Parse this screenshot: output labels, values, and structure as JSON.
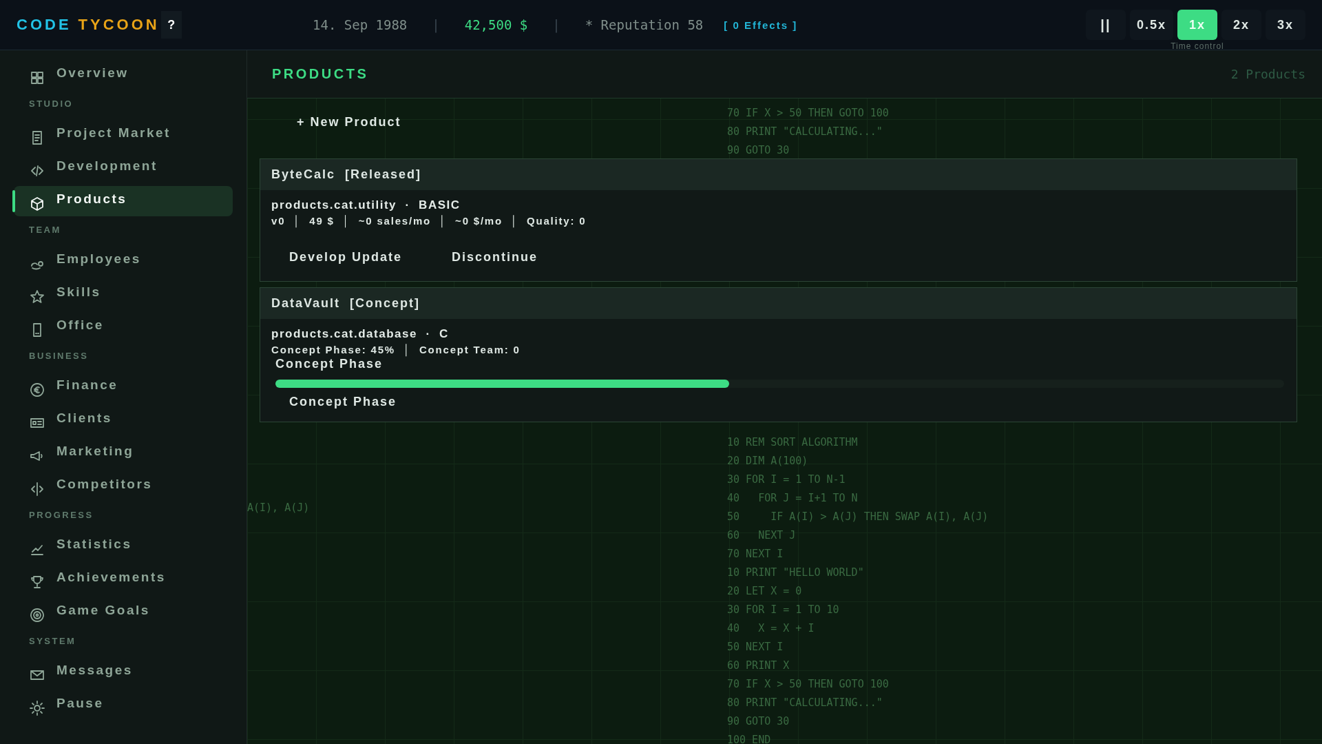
{
  "topbar": {
    "logo": [
      {
        "text": "CODE",
        "color": "#22c3e6"
      },
      {
        "text": "TYCOON",
        "color": "#e8a317"
      }
    ],
    "help": "?",
    "status": [
      {
        "kind": "date",
        "text": "14. Sep 1988"
      },
      {
        "kind": "sep",
        "text": "|"
      },
      {
        "kind": "money",
        "text": "42,500 $"
      },
      {
        "kind": "sep",
        "text": "|"
      },
      {
        "kind": "reputation",
        "text": "* Reputation 58"
      },
      {
        "kind": "effects",
        "text": "[ 0 Effects ]"
      }
    ],
    "pause": "||",
    "speeds": [
      {
        "label": "0.5x",
        "selected": false
      },
      {
        "label": "1x",
        "selected": true
      },
      {
        "label": "2x",
        "selected": false
      },
      {
        "label": "3x",
        "selected": false
      }
    ],
    "time_control_label": "Time control"
  },
  "sidebar": [
    {
      "items": [
        {
          "label": "Overview",
          "selected": false
        }
      ]
    },
    {
      "section": "STUDIO",
      "items": [
        {
          "label": "Project Market",
          "selected": false
        },
        {
          "label": "Development",
          "selected": false
        },
        {
          "label": "Products",
          "selected": true
        }
      ]
    },
    {
      "section": "TEAM",
      "items": [
        {
          "label": "Employees",
          "selected": false
        },
        {
          "label": "Skills",
          "selected": false
        },
        {
          "label": "Office",
          "selected": false
        }
      ]
    },
    {
      "section": "BUSINESS",
      "items": [
        {
          "label": "Finance",
          "selected": false
        },
        {
          "label": "Clients",
          "selected": false
        },
        {
          "label": "Marketing",
          "selected": false
        },
        {
          "label": "Competitors",
          "selected": false
        }
      ]
    },
    {
      "section": "PROGRESS",
      "items": [
        {
          "label": "Statistics",
          "selected": false
        },
        {
          "label": "Achievements",
          "selected": false
        },
        {
          "label": "Game Goals",
          "selected": false
        }
      ]
    },
    {
      "section": "SYSTEM",
      "items": [
        {
          "label": "Messages",
          "selected": false
        },
        {
          "label": "Pause",
          "selected": false
        }
      ]
    }
  ],
  "page": {
    "title": "PRODUCTS",
    "count": "2 Products",
    "new_button": "+ New Product",
    "products": [
      {
        "kind": "released",
        "name": "ByteCalc",
        "status": "[Released]",
        "category": "products.cat.utility  ·  BASIC",
        "stats": "v0  │  49 $  │  ~0 sales/mo  │  ~0 $/mo  │  Quality: 0",
        "actions": [
          "Develop Update",
          "Discontinue"
        ]
      },
      {
        "kind": "concept",
        "name": "DataVault",
        "status": "[Concept]",
        "category": "products.cat.database  ·  C",
        "stats": "Concept Phase: 45%  │  Concept Team: 0",
        "phase_label": "Concept Phase",
        "level": 0.45,
        "actions": [
          "Concept Phase"
        ]
      }
    ]
  },
  "background_code": [
    {
      "lines": [
        "70 IF X > 50 THEN GOTO 100",
        "80 PRINT \"CALCULATING...\"",
        "90 GOTO 30"
      ]
    },
    {
      "lines": [
        "10 REM SORT ALGORITHM",
        "20 DIM A(100)",
        "30 FOR I = 1 TO N-1",
        "40   FOR J = I+1 TO N",
        "50     IF A(I) > A(J) THEN SWAP A(I), A(J)",
        "60   NEXT J",
        "70 NEXT I",
        "10 PRINT \"HELLO WORLD\"",
        "20 LET X = 0",
        "30 FOR I = 1 TO 10",
        "40   X = X + I",
        "50 NEXT I",
        "60 PRINT X",
        "70 IF X > 50 THEN GOTO 100",
        "80 PRINT \"CALCULATING...\"",
        "90 GOTO 30",
        "100 END"
      ]
    },
    {
      "lines": [
        "A(I), A(J)"
      ]
    }
  ]
}
